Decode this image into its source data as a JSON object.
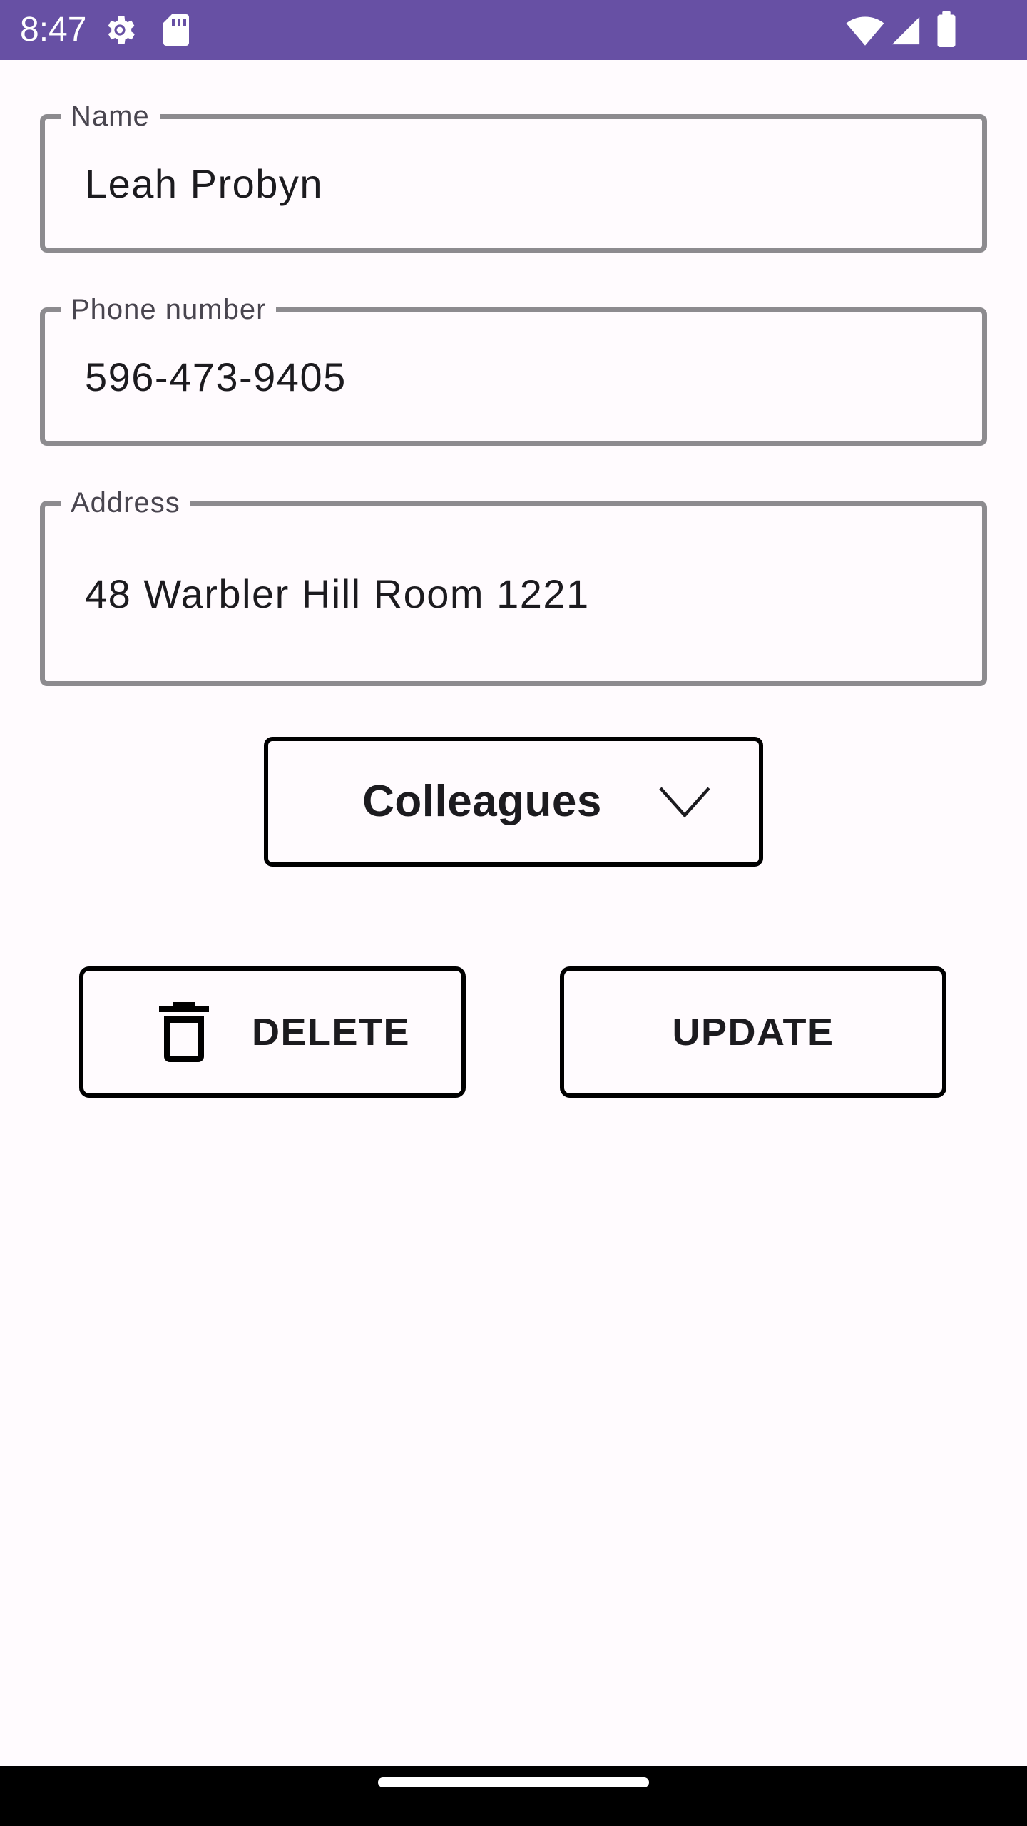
{
  "status_bar": {
    "time": "8:47",
    "icons": [
      "gear-icon",
      "sd-card-icon",
      "wifi-icon",
      "cell-signal-icon",
      "battery-icon"
    ],
    "background_color": "#6750a4"
  },
  "form": {
    "name": {
      "label": "Name",
      "value": "Leah Probyn"
    },
    "phone": {
      "label": "Phone number",
      "value": "596-473-9405"
    },
    "address": {
      "label": "Address",
      "value": "48 Warbler Hill Room 1221"
    },
    "group_dropdown": {
      "selected": "Colleagues",
      "icon": "chevron-down-icon"
    }
  },
  "actions": {
    "delete_label": "DELETE",
    "delete_icon": "trash-icon",
    "update_label": "UPDATE"
  },
  "colors": {
    "field_border": "#8d8b8f",
    "button_border": "#000000",
    "background": "#fffbfe",
    "text": "#1c1b1f"
  }
}
